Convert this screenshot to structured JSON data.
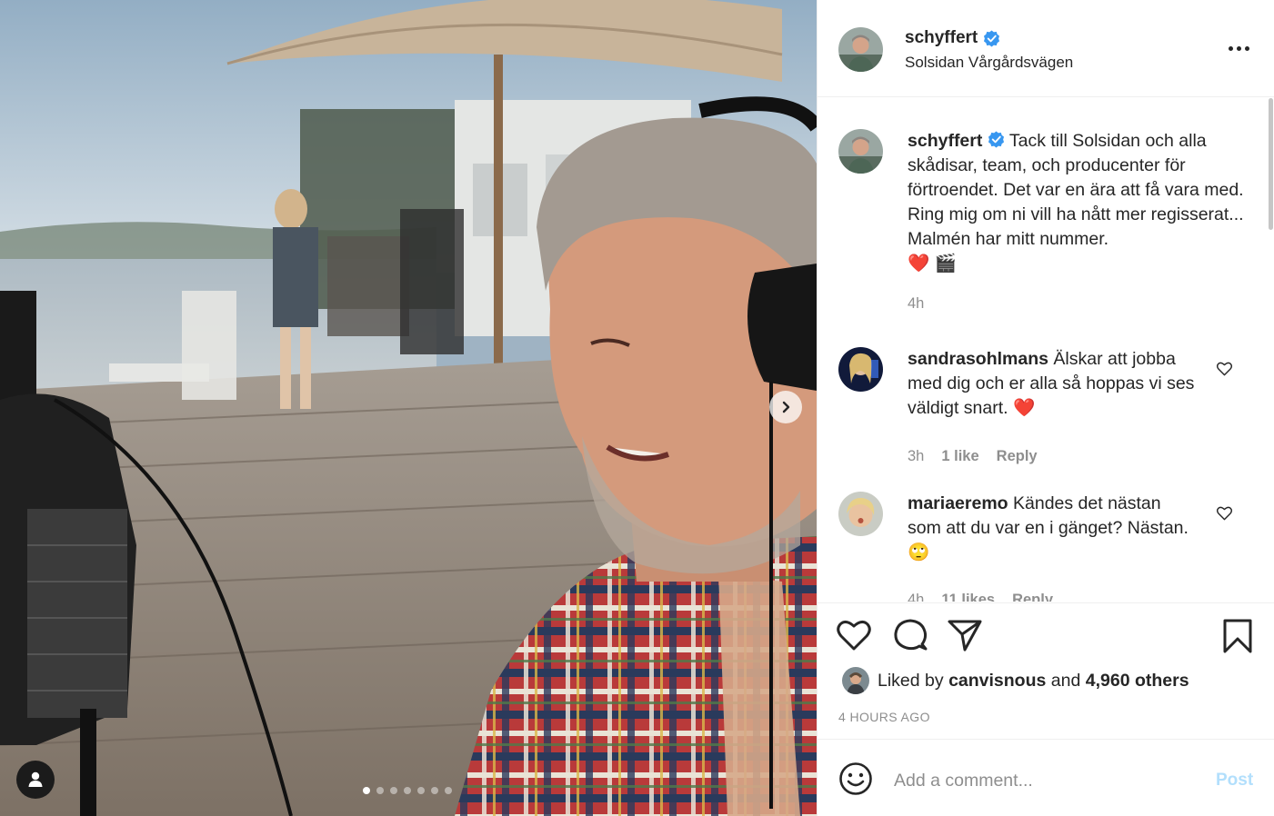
{
  "post": {
    "author": "schyffert",
    "location": "Solsidan Vårgårdsvägen",
    "carousel": {
      "slide_count": 7,
      "active_index": 0
    }
  },
  "caption": {
    "username": "schyffert",
    "text": "Tack till Solsidan och alla skådisar, team, och producenter för förtroendet. Det var en ära att få vara med. Ring mig om ni vill ha nått mer regisserat... Malmén har mitt nummer.",
    "emojis": "❤️ 🎬",
    "time": "4h"
  },
  "comments": [
    {
      "username": "sandrasohlmans",
      "text": "Älskar att jobba med dig och er alla så hoppas vi ses väldigt snart. ❤️",
      "time": "3h",
      "likes": "1 like",
      "reply": "Reply"
    },
    {
      "username": "mariaeremo",
      "text": "Kändes det nästan som att du var en i gänget? Nästan. 🙄",
      "time": "4h",
      "likes": "11 likes",
      "reply": "Reply"
    }
  ],
  "likes": {
    "prefix": "Liked by",
    "first_liker": "canvisnous",
    "and": "and",
    "others": "4,960 others"
  },
  "posted_ago": "4 HOURS AGO",
  "composer": {
    "placeholder": "Add a comment...",
    "post_label": "Post"
  },
  "colors": {
    "text": "#262626",
    "secondary": "#8e8e8e",
    "verified": "#3897f0",
    "post_disabled": "#b2dffc",
    "heart_red": "#ed4956"
  }
}
